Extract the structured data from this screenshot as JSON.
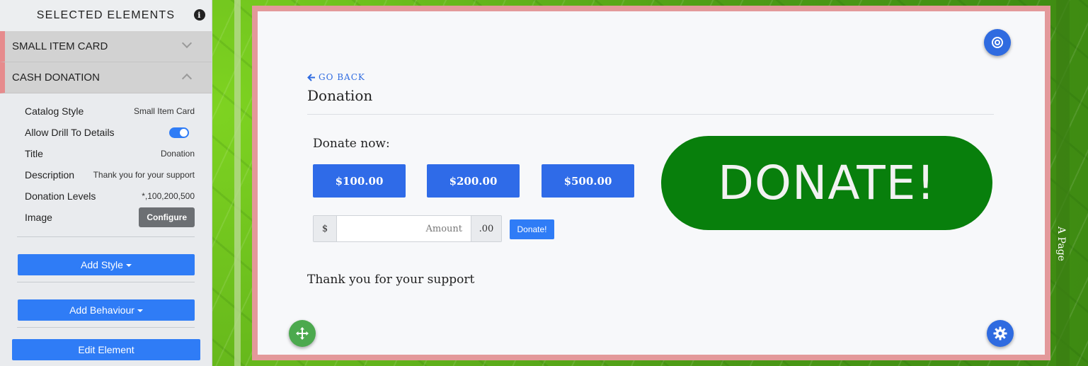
{
  "panel": {
    "header": "SELECTED ELEMENTS",
    "sections": [
      {
        "label": "SMALL ITEM CARD",
        "state": "collapsed"
      },
      {
        "label": "CASH DONATION",
        "state": "expanded"
      }
    ],
    "properties": {
      "catalog_style": {
        "label": "Catalog Style",
        "value": "Small Item Card"
      },
      "allow_drill": {
        "label": "Allow Drill To Details",
        "enabled": true
      },
      "title": {
        "label": "Title",
        "value": "Donation"
      },
      "description": {
        "label": "Description",
        "value": "Thank you for your support"
      },
      "donation_levels": {
        "label": "Donation Levels",
        "value": "*,100,200,500"
      },
      "image": {
        "label": "Image",
        "button": "Configure"
      }
    },
    "add_style": "Add Style",
    "add_behaviour": "Add Behaviour",
    "edit_element": "Edit Element"
  },
  "page": {
    "go_back": "GO BACK",
    "title": "Donation",
    "donate_now": "Donate now:",
    "amounts": [
      "$100.00",
      "$200.00",
      "$500.00"
    ],
    "currency_prefix": "$",
    "amount_placeholder": "Amount",
    "currency_suffix": ".00",
    "donate_button": "Donate!",
    "banner_text": "DONATE!",
    "description": "Thank you for your support",
    "side_tab": "A Page"
  },
  "colors": {
    "accent": "#2f7cf6",
    "banner_green": "#087f0c",
    "frame_pink": "#e3999a"
  }
}
